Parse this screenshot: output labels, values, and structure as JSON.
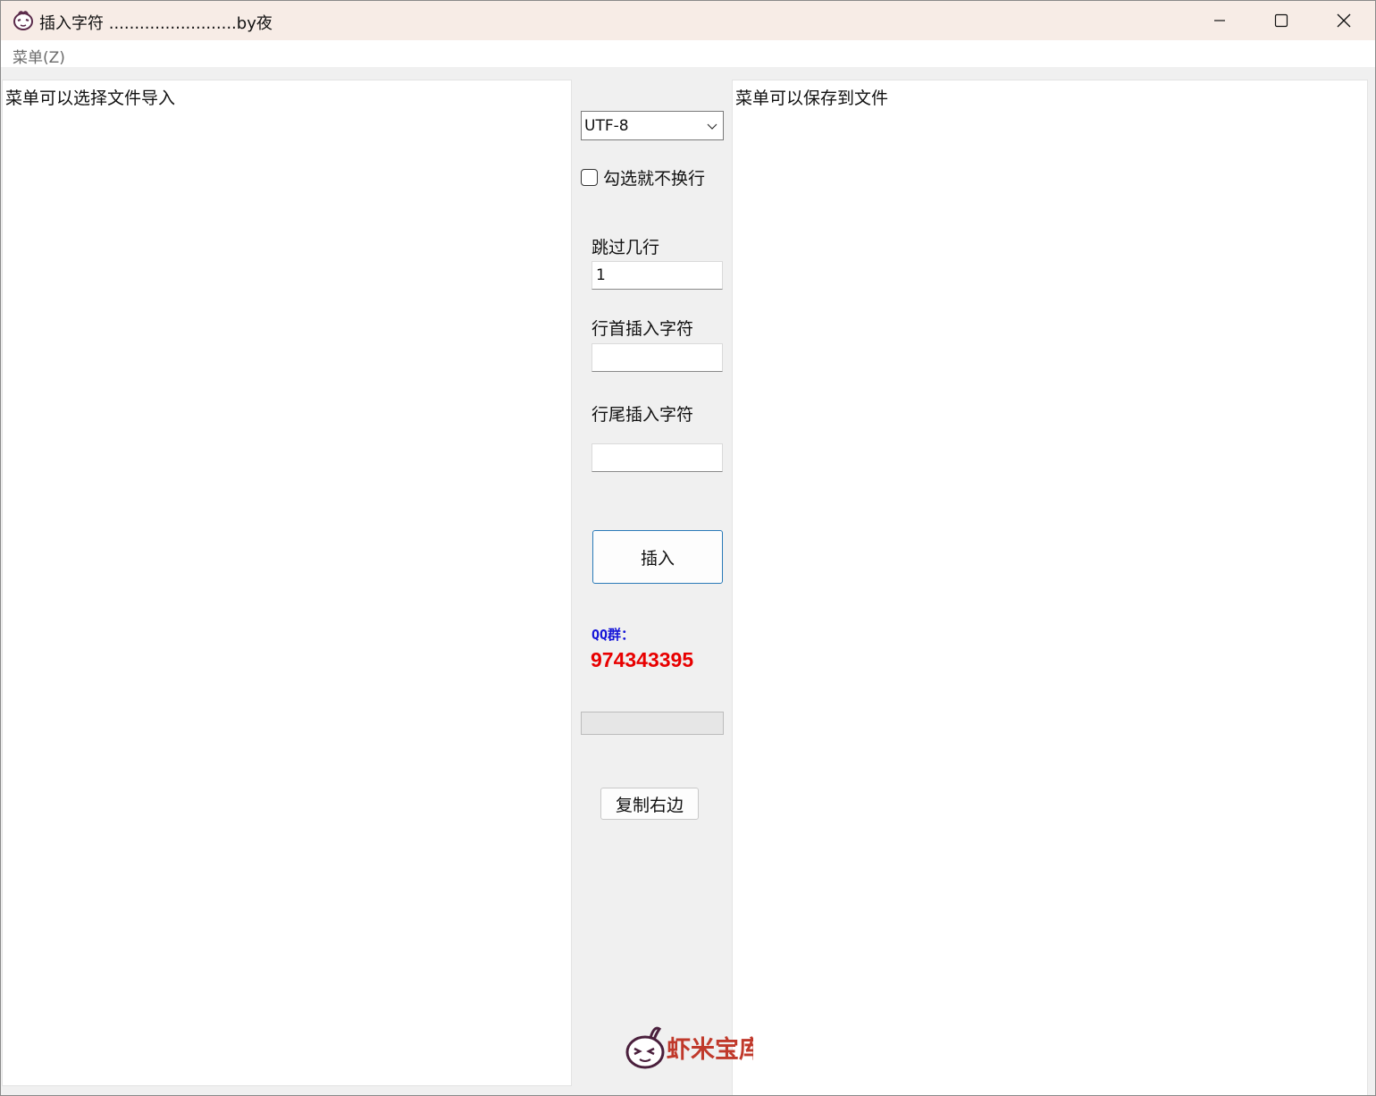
{
  "window": {
    "title": "插入字符 .........................by夜",
    "controls": {
      "minimize": "minimize-icon",
      "maximize": "maximize-icon",
      "close": "close-icon"
    }
  },
  "menubar": {
    "items": [
      {
        "label": "菜单(Z)"
      }
    ]
  },
  "left_pane": {
    "text": "菜单可以选择文件导入"
  },
  "right_pane": {
    "text": "菜单可以保存到文件"
  },
  "controls": {
    "encoding": {
      "selected": "UTF-8"
    },
    "no_wrap_checkbox": {
      "label": "勾选就不换行",
      "checked": false
    },
    "skip_lines": {
      "label": "跳过几行",
      "value": "1"
    },
    "line_start": {
      "label": "行首插入字符",
      "value": ""
    },
    "line_end": {
      "label": "行尾插入字符",
      "value": ""
    },
    "insert_button": {
      "label": "插入"
    },
    "qq": {
      "label": "QQ群：",
      "number": "974343395"
    },
    "progress": {
      "value": 0
    },
    "copy_button": {
      "label": "复制右边"
    }
  },
  "watermark": {
    "text": "虾米宝库"
  },
  "colors": {
    "qq_label": "#1515d8",
    "qq_number": "#e80000",
    "accent_border": "#2a7ab8",
    "watermark": "#c0392b"
  }
}
